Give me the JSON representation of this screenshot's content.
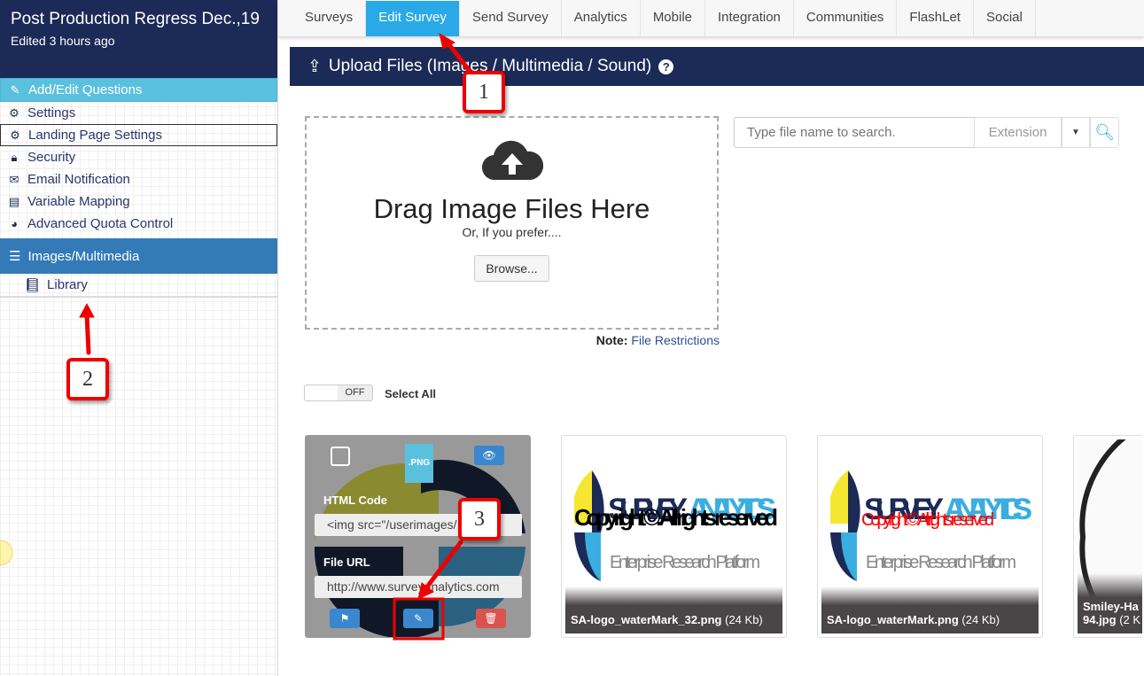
{
  "sidebar": {
    "title": "Post Production Regress Dec.,19",
    "subtitle": "Edited 3 hours ago",
    "items": [
      {
        "label": "Add/Edit Questions",
        "icon": "edit-icon"
      },
      {
        "label": "Settings",
        "icon": "gears-icon"
      },
      {
        "label": "Landing Page Settings",
        "icon": "gears-icon"
      },
      {
        "label": "Security",
        "icon": "lock-icon"
      },
      {
        "label": "Email Notification",
        "icon": "envelope-icon"
      },
      {
        "label": "Variable Mapping",
        "icon": "list-icon"
      },
      {
        "label": "Advanced Quota Control",
        "icon": "pie-chart-icon"
      }
    ],
    "section": {
      "label": "Images/Multimedia",
      "icon": "table-icon"
    },
    "sub_items": [
      {
        "label": "Library",
        "icon": "book-icon"
      }
    ]
  },
  "topnav": {
    "tabs": [
      "Surveys",
      "Edit Survey",
      "Send Survey",
      "Analytics",
      "Mobile",
      "Integration",
      "Communities",
      "FlashLet",
      "Social"
    ],
    "active": "Edit Survey"
  },
  "panel": {
    "title": "Upload Files (Images / Multimedia / Sound)",
    "help": "?",
    "drop_title": "Drag Image Files Here",
    "drop_sub": "Or, If you prefer....",
    "browse": "Browse...",
    "note_label": "Note:",
    "note_link": "File Restrictions",
    "search_placeholder": "Type file name to search.",
    "extension": "Extension",
    "toggle": "OFF",
    "select_all": "Select All"
  },
  "cards": [
    {
      "type_badge": ".PNG",
      "html_code_label": "HTML Code",
      "html_code": "<img src=\"/userimages/...\"/",
      "file_url_label": "File URL",
      "file_url": "http://www.surveyanalytics.com"
    },
    {
      "name": "SA-logo_waterMark_32.png",
      "size": "(24 Kb)",
      "watermark": "Copyright ©. All rights reserved",
      "watermark_color": "#000000"
    },
    {
      "name": "SA-logo_waterMark.png",
      "size": "(24 Kb)",
      "watermark": "Copyright ©. All rights reserved",
      "watermark_color": "#ff0000"
    },
    {
      "name": "Smiley-Ha 94.jpg",
      "size": "(2 K"
    }
  ],
  "logo": {
    "brand1": "SURVEY",
    "brand2": "ANALYTICS",
    "tagline": "Enterprise Research Platform"
  },
  "callouts": [
    "1",
    "2",
    "3"
  ],
  "colors": {
    "navy": "#1b2a56",
    "active_tab": "#2aa9e8",
    "sidebar_active": "#5bc0de",
    "section": "#337ab7",
    "callout": "#e00000"
  }
}
